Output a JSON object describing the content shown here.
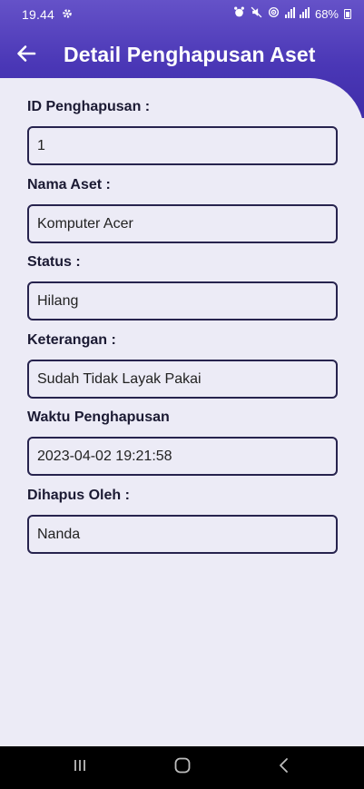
{
  "status_bar": {
    "time": "19.44",
    "settings_icon": "gear-icon",
    "battery": "68%"
  },
  "header": {
    "back_icon": "arrow-left-icon",
    "title": "Detail Penghapusan Aset"
  },
  "fields": [
    {
      "label": "ID Penghapusan :",
      "value": "1"
    },
    {
      "label": "Nama Aset :",
      "value": "Komputer Acer"
    },
    {
      "label": "Status :",
      "value": "Hilang"
    },
    {
      "label": "Keterangan :",
      "value": "Sudah Tidak Layak Pakai"
    },
    {
      "label": "Waktu Penghapusan",
      "value": "2023-04-02 19:21:58"
    },
    {
      "label": "Dihapus Oleh :",
      "value": "Nanda"
    }
  ],
  "nav": {
    "recents_icon": "recents-icon",
    "home_icon": "home-icon",
    "back_icon": "nav-back-icon"
  },
  "colors": {
    "header_top": "#6552c8",
    "header_bottom": "#3f2da8",
    "background": "#ecebf6",
    "field_border": "#27234e"
  }
}
